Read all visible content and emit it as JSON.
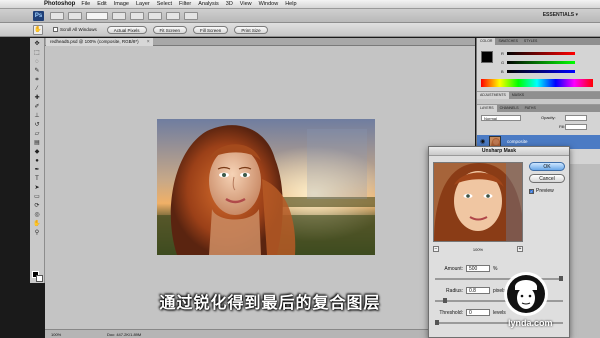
{
  "menubar": {
    "app_name": "Photoshop",
    "items": [
      "File",
      "Edit",
      "Image",
      "Layer",
      "Select",
      "Filter",
      "Analysis",
      "3D",
      "View",
      "Window",
      "Help"
    ]
  },
  "appbar": {
    "logo": "Ps",
    "workspace": "ESSENTIALS ▾"
  },
  "options": {
    "scroll_all_windows": "Scroll All Windows",
    "buttons": [
      "Actual Pixels",
      "Fit Screen",
      "Fill Screen",
      "Print Size"
    ]
  },
  "document": {
    "tab_title": "redhead5.psd @ 100% (composite, RGB/8*)",
    "status_zoom": "100%",
    "status_doc": "Doc: 447.2K/1.89M"
  },
  "panels": {
    "color_tabs": [
      "COLOR",
      "SWATCHES",
      "STYLES"
    ],
    "color_channels": [
      "R",
      "G",
      "B"
    ],
    "adjust_tabs": [
      "ADJUSTMENTS",
      "MASKS"
    ],
    "layer_tabs": [
      "LAYERS",
      "CHANNELS",
      "PATHS"
    ],
    "blend_mode": "Normal",
    "opacity_label": "Opacity:",
    "fill_label": "Fill:",
    "layer_name": "composite"
  },
  "dialog": {
    "title": "Unsharp Mask",
    "ok": "OK",
    "cancel": "Cancel",
    "preview_label": "Preview",
    "preview_zoom": "100%",
    "amount_label": "Amount:",
    "amount_value": "500",
    "amount_unit": "%",
    "radius_label": "Radius:",
    "radius_value": "0.8",
    "radius_unit": "pixels",
    "threshold_label": "Threshold:",
    "threshold_value": "0",
    "threshold_unit": "levels"
  },
  "subtitle": "通过锐化得到最后的复合图层",
  "watermark": "lynda.com"
}
